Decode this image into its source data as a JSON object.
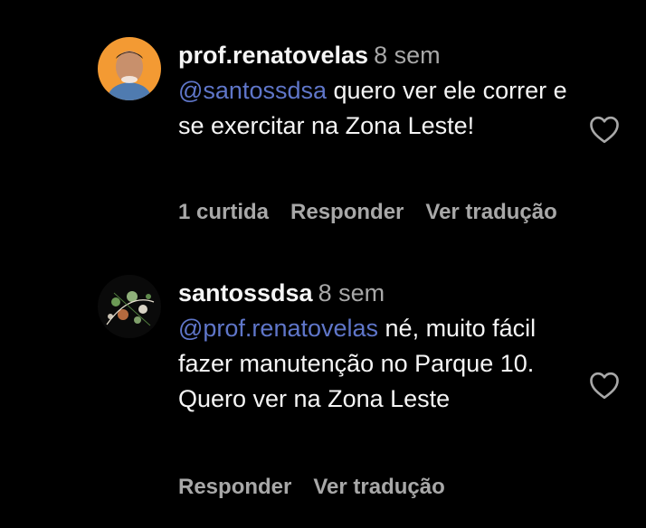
{
  "comments": [
    {
      "username": "prof.renatovelas",
      "time": "8 sem",
      "mention": "@santossdsa",
      "text": " quero ver ele correr e se exercitar na Zona Leste!",
      "likes": "1 curtida",
      "reply": "Responder",
      "translate": "Ver tradução"
    },
    {
      "username": "santossdsa",
      "time": "8 sem",
      "mention": "@prof.renatovelas",
      "text": " né, muito fácil fazer manutenção no Parque 10. Quero ver na Zona Leste",
      "reply": "Responder",
      "translate": "Ver tradução"
    }
  ],
  "icons": {
    "like": "heart-outline-icon"
  },
  "colors": {
    "background": "#000000",
    "text": "#f5f5f5",
    "muted": "#a8a8a8",
    "mention": "#5f76c9"
  }
}
